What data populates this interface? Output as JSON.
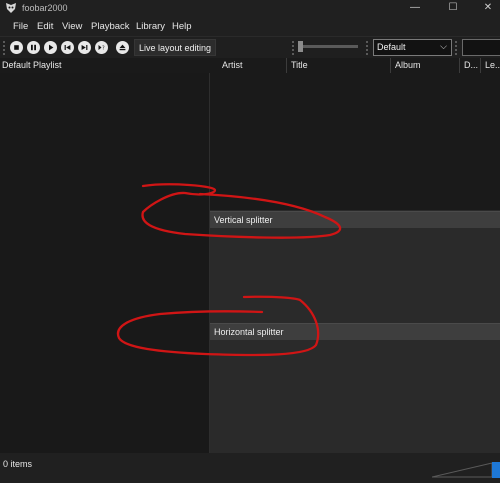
{
  "window": {
    "title": "foobar2000",
    "minimize_glyph": "—",
    "maximize_glyph": "☐",
    "close_glyph": "✕"
  },
  "menu": {
    "items": [
      "File",
      "Edit",
      "View",
      "Playback",
      "Library",
      "Help"
    ]
  },
  "toolbar": {
    "buttons": [
      "stop-icon",
      "pause-icon",
      "play-icon",
      "previous-icon",
      "next-icon",
      "random-icon",
      "eject-icon"
    ],
    "live_layout_label": "Live layout editing",
    "dropdown_value": "Default",
    "dropdown_chevron": "⌵"
  },
  "playlist": {
    "title": "Default Playlist",
    "columns": [
      "Artist",
      "Title",
      "Album",
      "D...",
      "Le..."
    ]
  },
  "splitters": {
    "vertical": "Vertical splitter",
    "horizontal": "Horizontal splitter"
  },
  "status": {
    "text": "0 items"
  },
  "colors": {
    "annotation": "#d01515",
    "volume_thumb": "#1e78d6"
  }
}
